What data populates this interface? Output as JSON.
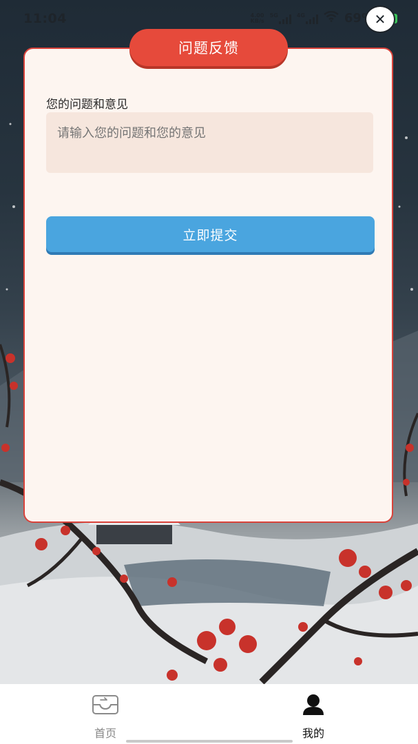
{
  "status_bar": {
    "time": "11:04",
    "net_top": "4.00",
    "net_bottom": "KB/s",
    "signal1_label": "5G",
    "signal2_label": "4G",
    "battery": "69%",
    "battery_color": "#3bc35a"
  },
  "page": {
    "title": "问题反馈",
    "field_label": "您的问题和意见",
    "feedback_placeholder": "请输入您的问题和您的意见",
    "feedback_value": "",
    "submit_label": "立即提交"
  },
  "tabbar": {
    "items": [
      {
        "label": "首页",
        "icon": "inbox-icon",
        "active": false
      },
      {
        "label": "我的",
        "icon": "user-icon",
        "active": true
      }
    ]
  },
  "colors": {
    "accent_red": "#e64a3b",
    "button_blue": "#4aa5df",
    "card_bg": "#fdf5f0"
  }
}
